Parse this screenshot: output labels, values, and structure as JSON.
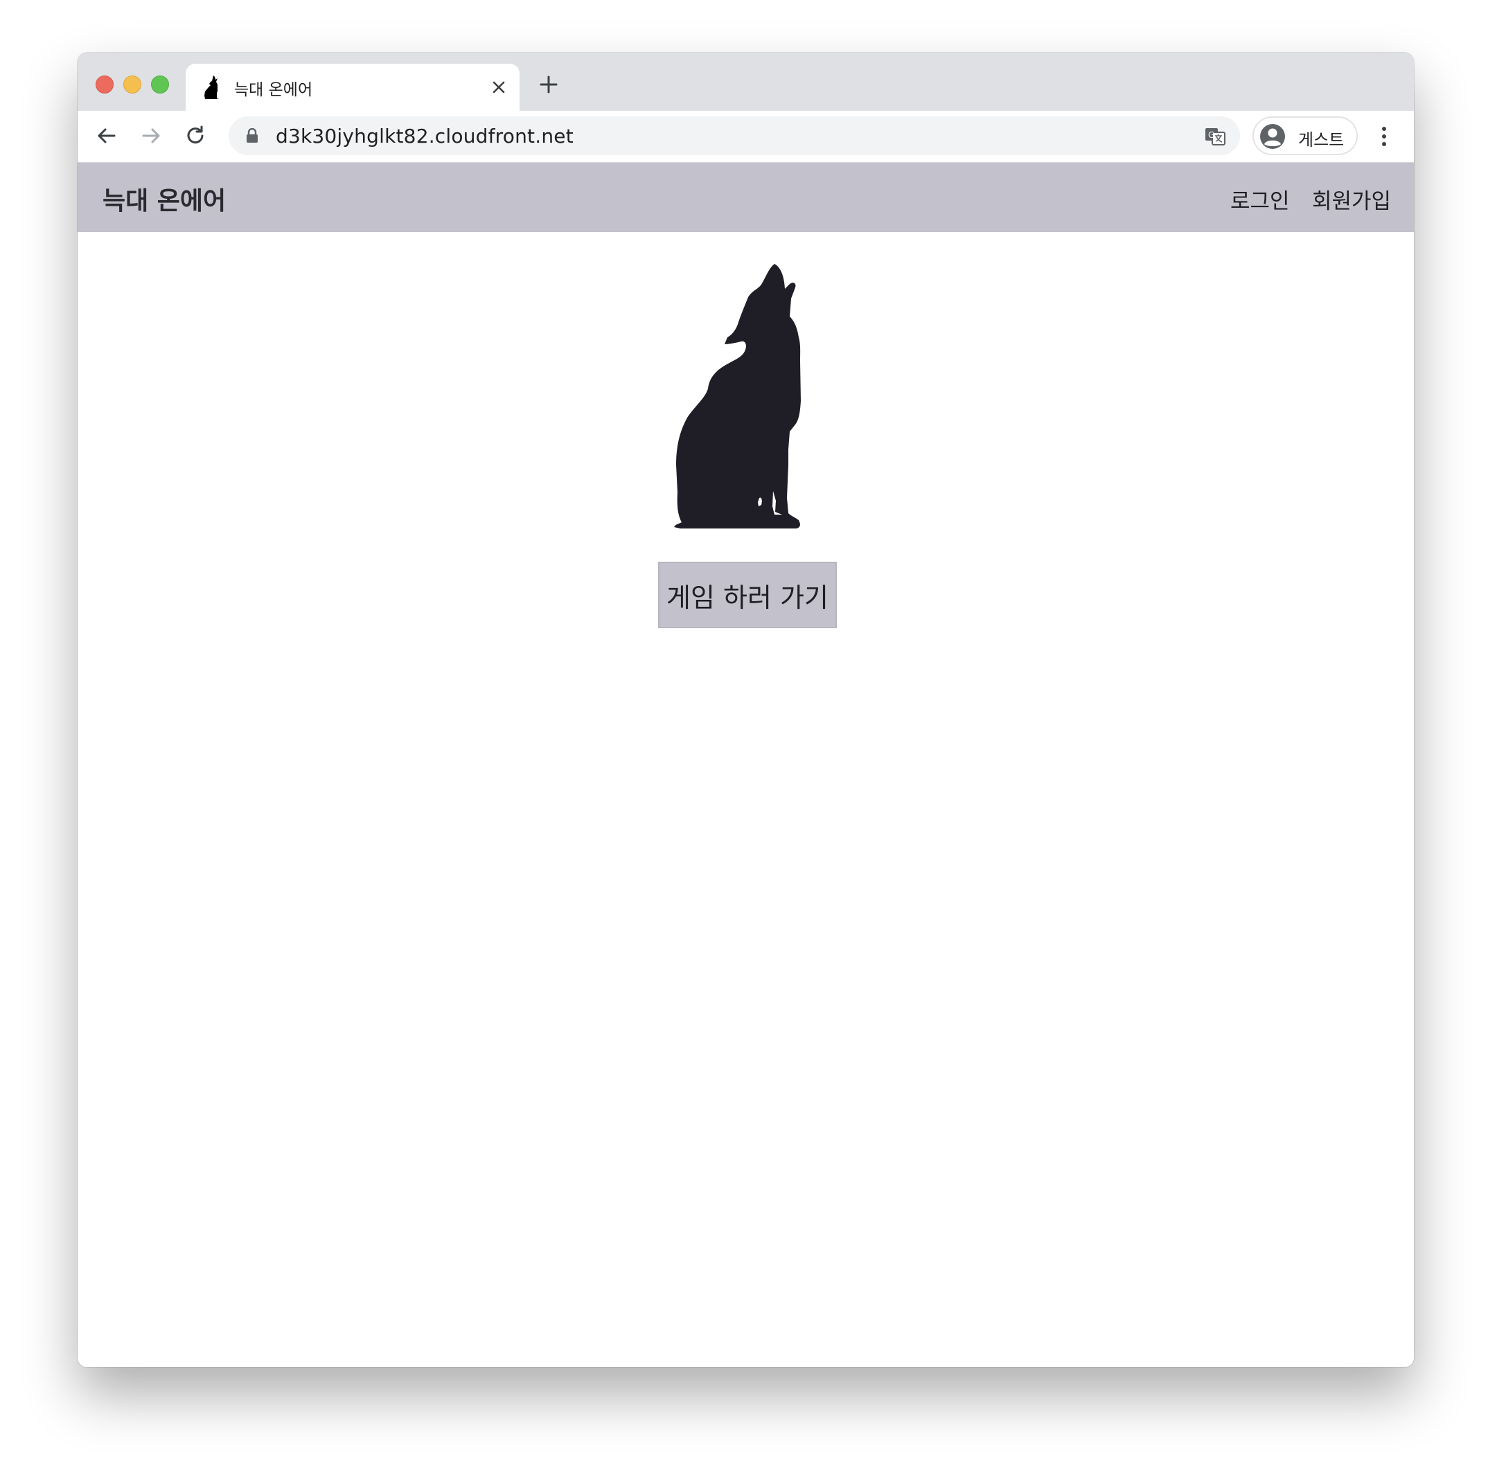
{
  "browser": {
    "tab": {
      "title": "늑대 온에어",
      "favicon": "wolf-icon"
    },
    "new_tab_icon": "plus-icon",
    "close_tab_icon": "close-icon",
    "nav": {
      "back_icon": "arrow-left-icon",
      "forward_icon": "arrow-right-icon",
      "reload_icon": "reload-icon"
    },
    "address_bar": {
      "url": "d3k30jyhglkt82.cloudfront.net",
      "lock_icon": "lock-icon",
      "translate_icon": "translate-icon"
    },
    "profile": {
      "label": "게스트",
      "avatar_icon": "user-avatar-icon"
    },
    "menu_icon": "kebab-menu-icon"
  },
  "site": {
    "brand": "늑대 온에어",
    "nav": {
      "login": "로그인",
      "signup": "회원가입"
    },
    "hero": {
      "image": "howling-wolf-silhouette",
      "cta_label": "게임 하러 가기"
    }
  },
  "colors": {
    "nav_background": "#c3c2cc",
    "silhouette": "#1f1e27",
    "button_background": "#c3c2cc",
    "tabstrip": "#dfe0e4"
  }
}
